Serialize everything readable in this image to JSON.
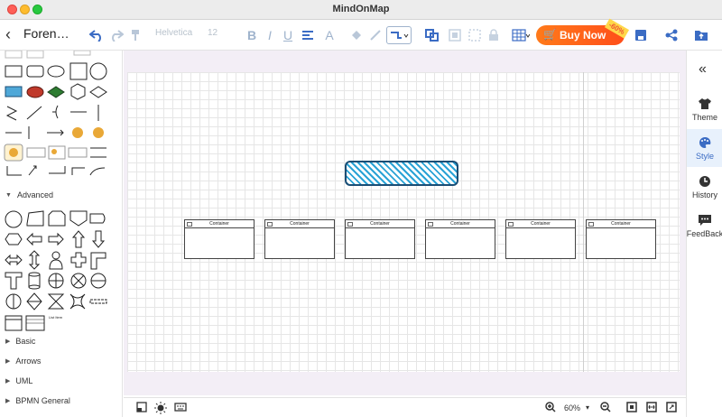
{
  "app": {
    "title": "MindOnMap"
  },
  "toolbar": {
    "doc_title": "Foren…",
    "font_family": "Helvetica",
    "font_size": "12",
    "buy_label": "Buy Now",
    "discount": "-60%"
  },
  "left_panel": {
    "sections": [
      "Advanced",
      "Basic",
      "Arrows",
      "UML",
      "BPMN General"
    ],
    "advanced_list_label": "List Item"
  },
  "canvas": {
    "container_label": "Container",
    "container_count": 6
  },
  "bottom_bar": {
    "zoom": "60%"
  },
  "right_panel": {
    "items": [
      {
        "label": "Theme",
        "icon": "shirt-icon"
      },
      {
        "label": "Style",
        "icon": "palette-icon"
      },
      {
        "label": "History",
        "icon": "clock-icon"
      },
      {
        "label": "FeedBack",
        "icon": "feedback-icon"
      }
    ]
  },
  "colors": {
    "accent": "#3b6cc4",
    "buy_now": "#ff5a1a",
    "hatch": "#2aa3d6"
  }
}
